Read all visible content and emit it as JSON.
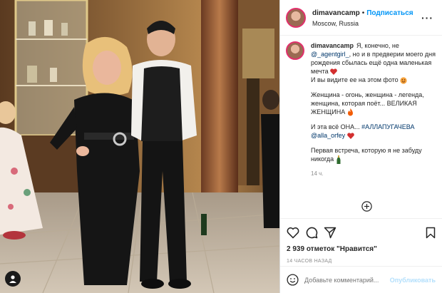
{
  "header": {
    "username": "dimavancamp",
    "dot": "•",
    "follow_label": "Подписаться",
    "location": "Moscow, Russia",
    "more_label": "···"
  },
  "caption": {
    "username": "dimavancamp",
    "line1_before": "Я, конечно, не",
    "mention1": "@_agentgirl_",
    "line1_after": ", но и в предверии моего дня рождения сбылась ещё одна маленькая мечта",
    "line2": "И вы видите ее на этом фото",
    "para2": "Женщина - огонь, женщина - легенда, женщина, которая поёт... ВЕЛИКАЯ ЖЕНЩИНА",
    "para3_before": "И эта всё ОНА...",
    "hashtag": "#АЛЛАПУГАЧЕВА",
    "mention2": "@alla_orfey",
    "para4": "Первая встреча, которую я не забуду никогда",
    "age": "14 ч."
  },
  "icons": [
    "heart-outline-icon",
    "comment-icon",
    "share-icon",
    "bookmark-icon",
    "emoji-icon",
    "plus-circle-icon",
    "user-icon"
  ],
  "likes": {
    "count": "2 939",
    "label": "отметок \"Нравится\""
  },
  "time_ago": "14 ЧАСОВ НАЗАД",
  "add_comment": {
    "placeholder": "Добавьте комментарий...",
    "publish_label": "Опубликовать"
  },
  "colors": {
    "link": "#0095f6",
    "tag": "#00376b",
    "muted": "#8e8e8e",
    "publish_disabled": "#b2dffc"
  }
}
